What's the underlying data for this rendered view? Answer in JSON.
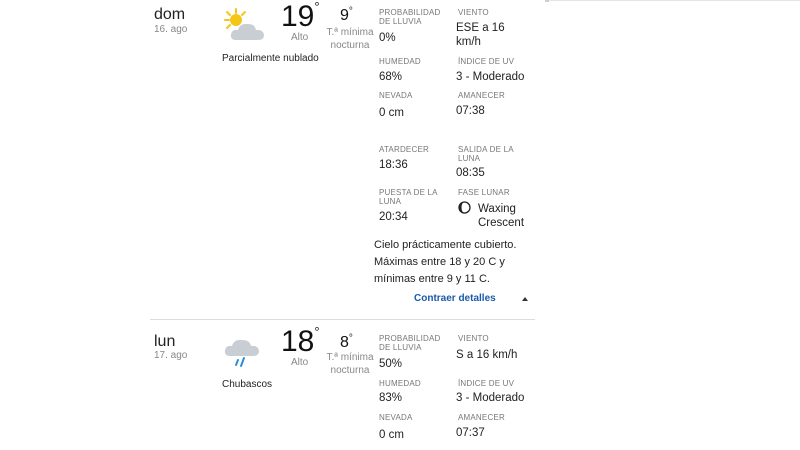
{
  "days": [
    {
      "name": "dom",
      "date": "16. ago",
      "condition": "Parcialmente nublado",
      "icon": "partly-cloudy-icon",
      "high": "19",
      "high_label": "Alto",
      "low": "9",
      "low_label": "T.ª mínima nocturna",
      "details": {
        "rain_prob_label": "PROBABILIDAD DE LLUVIA",
        "rain_prob": "0%",
        "wind_label": "VIENTO",
        "wind": "ESE a 16 km/h",
        "humidity_label": "HUMEDAD",
        "humidity": "68%",
        "uv_label": "ÍNDICE DE UV",
        "uv": "3 - Moderado",
        "snow_label": "NEVADA",
        "snow": "0 cm",
        "sunrise_label": "AMANECER",
        "sunrise": "07:38",
        "sunset_label": "ATARDECER",
        "sunset": "18:36",
        "moonrise_label": "SALIDA DE LA LUNA",
        "moonrise": "08:35",
        "moonset_label": "PUESTA DE LA LUNA",
        "moonset": "20:34",
        "moon_phase_label": "FASE LUNAR",
        "moon_phase": "Waxing Crescent"
      },
      "summary": "Cielo prácticamente cubierto. Máximas entre 18 y 20 C y mínimas entre 9 y 11 C.",
      "collapse_label": "Contraer detalles"
    },
    {
      "name": "lun",
      "date": "17. ago",
      "condition": "Chubascos",
      "icon": "showers-icon",
      "high": "18",
      "high_label": "Alto",
      "low": "8",
      "low_label": "T.ª mínima nocturna",
      "details": {
        "rain_prob_label": "PROBABILIDAD DE LLUVIA",
        "rain_prob": "50%",
        "wind_label": "VIENTO",
        "wind": "S a 16 km/h",
        "humidity_label": "HUMEDAD",
        "humidity": "83%",
        "uv_label": "ÍNDICE DE UV",
        "uv": "3 - Moderado",
        "snow_label": "NEVADA",
        "snow": "0 cm",
        "sunrise_label": "AMANECER",
        "sunrise": "07:37"
      }
    }
  ],
  "degree_symbol": "°",
  "colors": {
    "link": "#1a5aa8",
    "sun": "#f5c518",
    "cloud": "#c9ced4",
    "rain": "#2e8bd6"
  }
}
